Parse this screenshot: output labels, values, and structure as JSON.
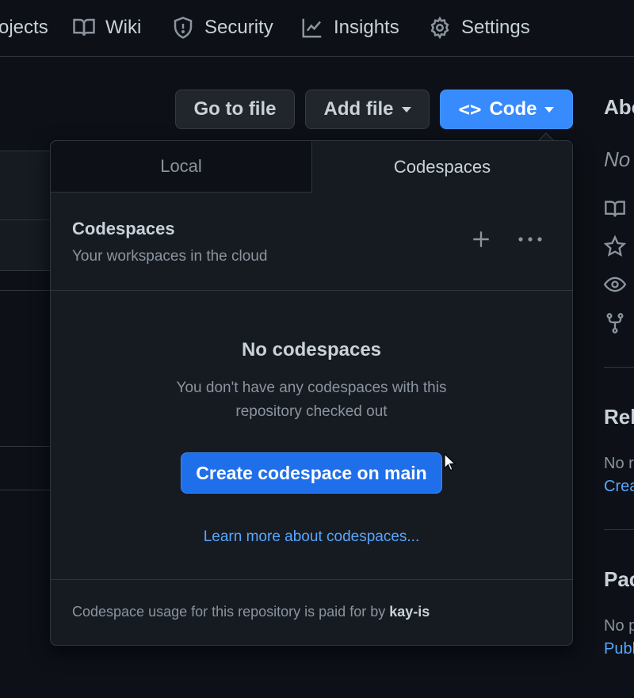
{
  "nav": {
    "projects": "ojects",
    "wiki": "Wiki",
    "security": "Security",
    "insights": "Insights",
    "settings": "Settings"
  },
  "toolbar": {
    "goto_file": "Go to file",
    "add_file": "Add file",
    "code": "Code",
    "code_icon": "<>"
  },
  "popover": {
    "tabs": [
      "Local",
      "Codespaces"
    ],
    "active_tab": "Codespaces",
    "header_title": "Codespaces",
    "header_subtitle": "Your workspaces in the cloud",
    "empty_title": "No codespaces",
    "empty_desc": "You don't have any codespaces with this repository checked out",
    "create_button": "Create codespace on main",
    "learn_more": "Learn more about codespaces...",
    "footer_prefix": "Codespace usage for this repository is paid for by ",
    "footer_owner": "kay-is"
  },
  "sidebar": {
    "about_heading": "Abo",
    "about_desc": "No",
    "releases_heading": "Rel",
    "releases_text": "No r",
    "releases_link": "Crea",
    "packages_heading": "Pac",
    "packages_text": "No p",
    "packages_link": "Publ",
    "icons": [
      "book-icon",
      "star-icon",
      "eye-icon",
      "fork-icon"
    ]
  },
  "colors": {
    "background": "#0d1117",
    "panel": "#161b22",
    "border": "#30363d",
    "accent_blue": "#1f6feb",
    "link_blue": "#58a6ff",
    "text": "#c9d1d9",
    "muted": "#8b949e"
  }
}
